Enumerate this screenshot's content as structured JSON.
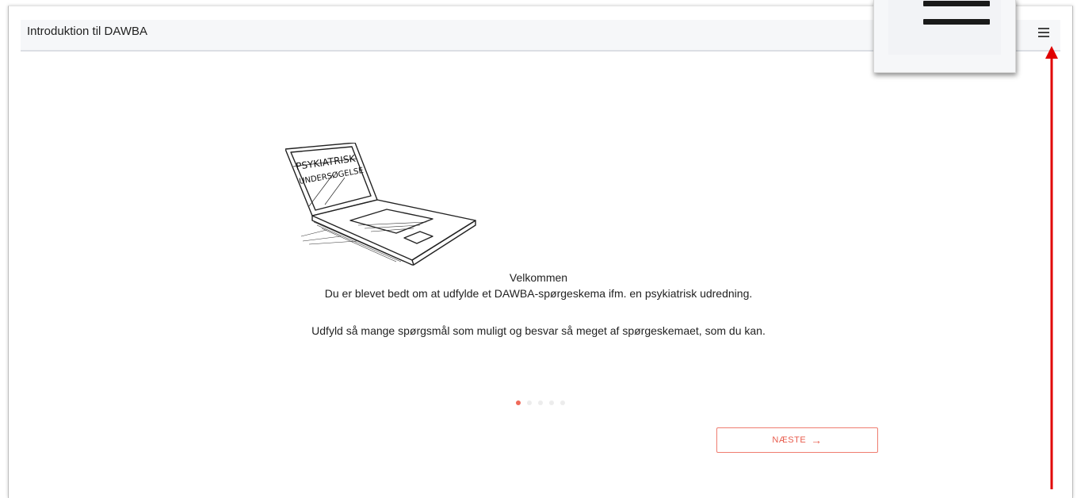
{
  "header": {
    "title": "Introduktion til DAWBA",
    "menu_icon": "hamburger-menu-icon"
  },
  "illustration": {
    "screen_text_line1": "PSYKIATRISK",
    "screen_text_line2": "UNDERSØGELSE"
  },
  "content": {
    "heading": "Velkommen",
    "line1": "Du er blevet bedt om at udfylde et DAWBA-spørgeskema ifm. en psykiatrisk udredning.",
    "line2": "Udfyld så mange spørgsmål som muligt og besvar så meget af spørgeskemaet, som du kan."
  },
  "pagination": {
    "total": 5,
    "current": 1
  },
  "navigation": {
    "next_label": "NÆSTE",
    "next_icon": "arrow-right-icon"
  },
  "colors": {
    "accent": "#e85c4d",
    "annotation_arrow": "#e00000"
  }
}
